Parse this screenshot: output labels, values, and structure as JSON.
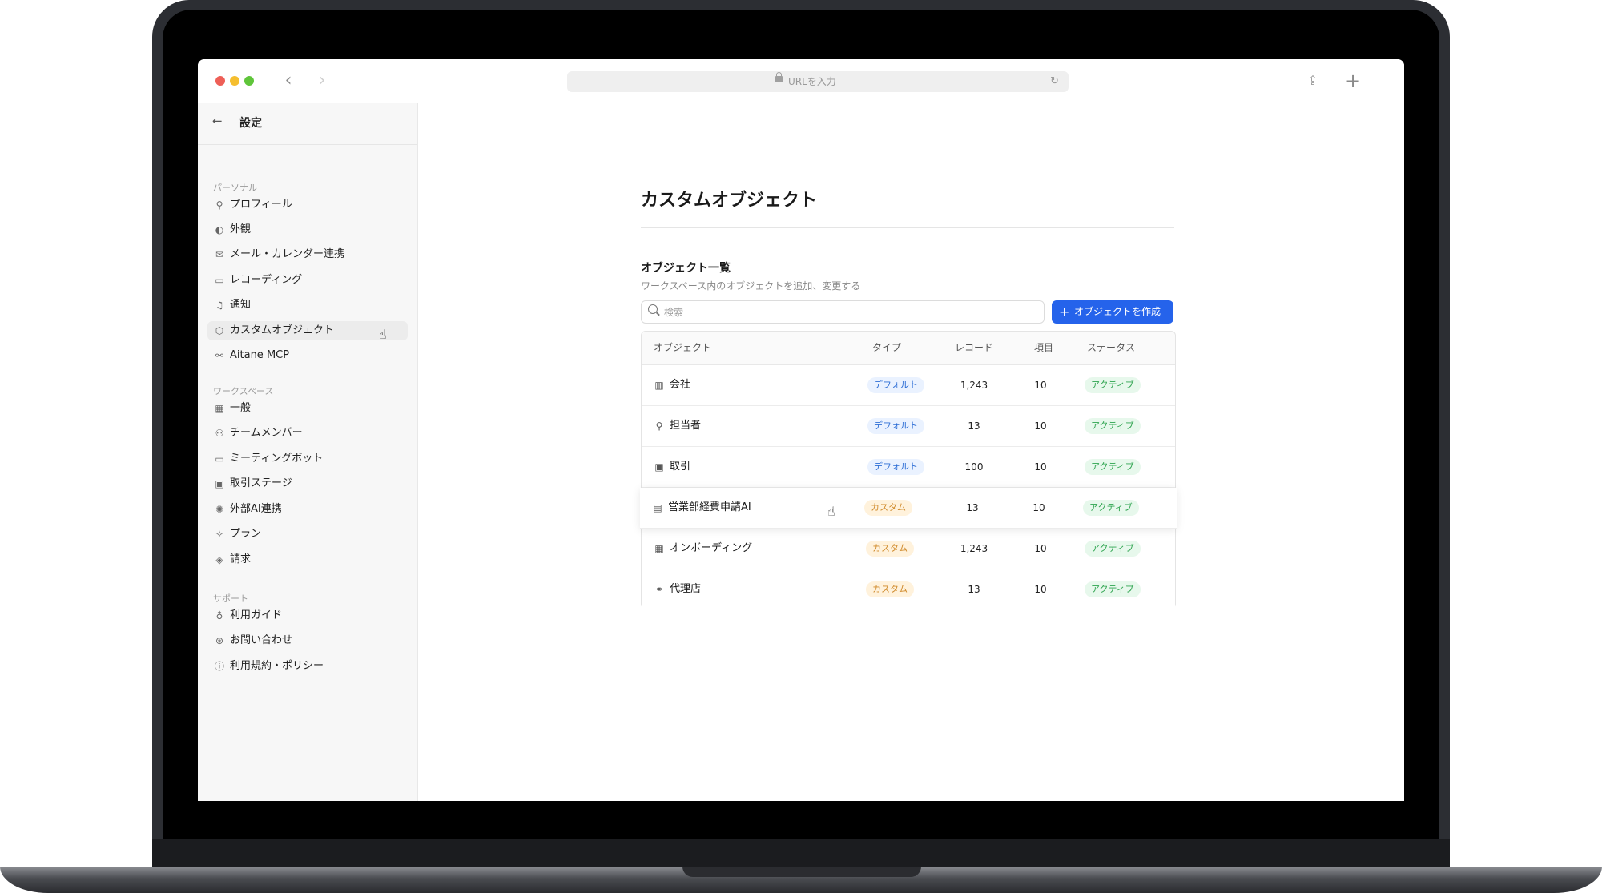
{
  "browser": {
    "url_placeholder": "URLを入力",
    "icons": [
      "back-arrow-icon",
      "forward-arrow-icon",
      "lock-icon",
      "reload-icon",
      "share-icon",
      "new-tab-icon"
    ]
  },
  "sidebar": {
    "title": "設定",
    "sections": [
      {
        "heading": "パーソナル",
        "items": [
          {
            "label": "プロフィール",
            "icon": "user-icon"
          },
          {
            "label": "外観",
            "icon": "palette-icon"
          },
          {
            "label": "メール・カレンダー連携",
            "icon": "mail-icon"
          },
          {
            "label": "レコーディング",
            "icon": "video-icon"
          },
          {
            "label": "通知",
            "icon": "bell-icon"
          },
          {
            "label": "カスタムオブジェクト",
            "icon": "cube-icon",
            "active": true
          },
          {
            "label": "Aitane MCP",
            "icon": "connector-icon"
          }
        ]
      },
      {
        "heading": "ワークスペース",
        "items": [
          {
            "label": "一般",
            "icon": "grid-icon"
          },
          {
            "label": "チームメンバー",
            "icon": "users-icon"
          },
          {
            "label": "ミーティングボット",
            "icon": "video-icon"
          },
          {
            "label": "取引ステージ",
            "icon": "deal-icon"
          },
          {
            "label": "外部AI連携",
            "icon": "ai-icon"
          },
          {
            "label": "プラン",
            "icon": "sparkle-icon"
          },
          {
            "label": "請求",
            "icon": "tag-icon"
          }
        ]
      },
      {
        "heading": "サポート",
        "items": [
          {
            "label": "利用ガイド",
            "icon": "bulb-icon"
          },
          {
            "label": "お問い合わせ",
            "icon": "lifebuoy-icon"
          },
          {
            "label": "利用規約・ポリシー",
            "icon": "info-icon"
          }
        ]
      }
    ]
  },
  "main": {
    "page_title": "カスタムオブジェクト",
    "section_title": "オブジェクト一覧",
    "section_desc": "ワークスペース内のオブジェクトを追加、変更する",
    "search_placeholder": "検索",
    "create_button": "オブジェクトを作成",
    "table": {
      "headers": {
        "object": "オブジェクト",
        "type": "タイプ",
        "records": "レコード",
        "fields": "項目",
        "status": "ステータス"
      },
      "rows": [
        {
          "name": "会社",
          "icon": "building-icon",
          "type": "デフォルト",
          "records": "1,243",
          "fields": "10",
          "status": "アクティブ"
        },
        {
          "name": "担当者",
          "icon": "user-icon",
          "type": "デフォルト",
          "records": "13",
          "fields": "10",
          "status": "アクティブ"
        },
        {
          "name": "取引",
          "icon": "deal-icon",
          "type": "デフォルト",
          "records": "100",
          "fields": "10",
          "status": "アクティブ"
        },
        {
          "name": "営業部経費申請AI",
          "icon": "document-icon",
          "type": "カスタム",
          "records": "13",
          "fields": "10",
          "status": "アクティブ"
        },
        {
          "name": "オンボーディング",
          "icon": "clipboard-icon",
          "type": "カスタム",
          "records": "1,243",
          "fields": "10",
          "status": "アクティブ"
        },
        {
          "name": "代理店",
          "icon": "handshake-icon",
          "type": "カスタム",
          "records": "13",
          "fields": "10",
          "status": "アクティブ"
        }
      ]
    }
  },
  "colors": {
    "accent": "#2563eb",
    "badge_default": "#2f6fd6",
    "badge_custom": "#d08a2a",
    "badge_status": "#2ea44f"
  }
}
